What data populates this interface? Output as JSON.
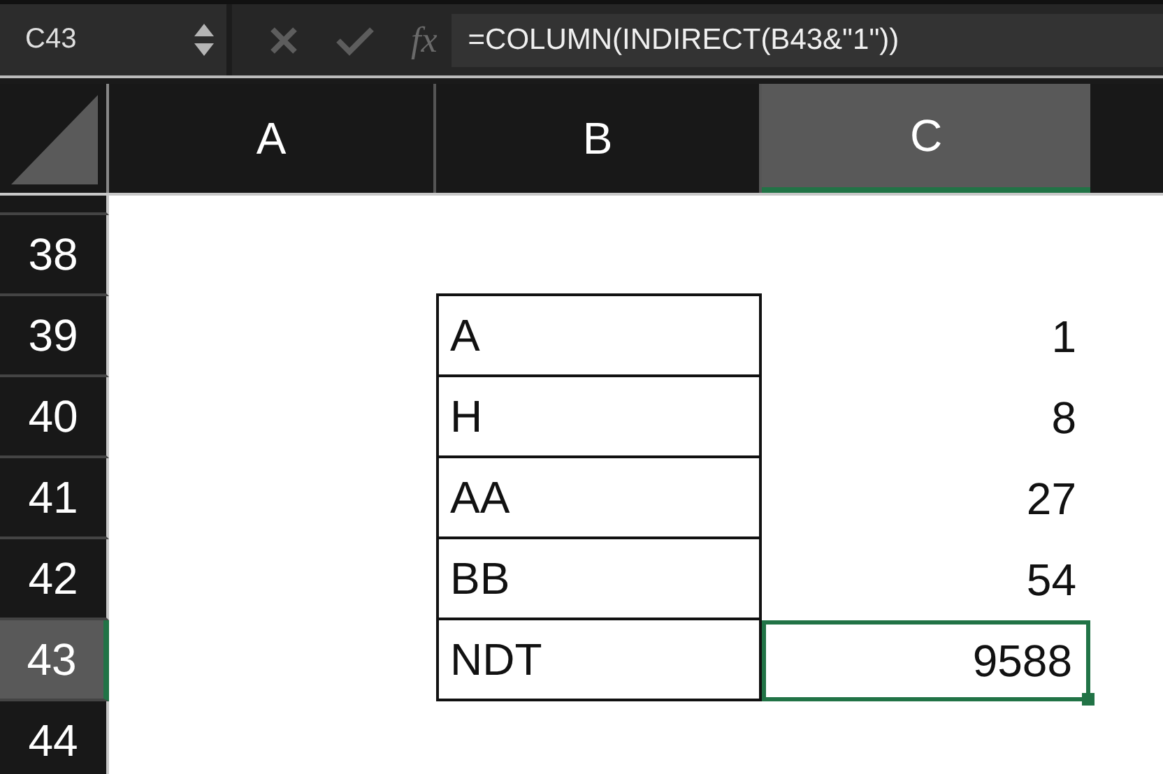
{
  "name_box": "C43",
  "formula_bar": {
    "fx_label": "fx",
    "formula": "=COLUMN(INDIRECT(B43&\"1\"))"
  },
  "columns": [
    {
      "label": "A",
      "selected": false
    },
    {
      "label": "B",
      "selected": false
    },
    {
      "label": "C",
      "selected": true
    }
  ],
  "rows": [
    {
      "header": "38",
      "selected": false,
      "boxed": false
    },
    {
      "header": "39",
      "selected": false,
      "boxed": true,
      "b": "A",
      "c": "1"
    },
    {
      "header": "40",
      "selected": false,
      "boxed": true,
      "b": "H",
      "c": "8"
    },
    {
      "header": "41",
      "selected": false,
      "boxed": true,
      "b": "AA",
      "c": "27"
    },
    {
      "header": "42",
      "selected": false,
      "boxed": true,
      "b": "BB",
      "c": "54"
    },
    {
      "header": "43",
      "selected": true,
      "boxed": true,
      "b": "NDT",
      "c": "9588"
    },
    {
      "header": "44",
      "selected": false,
      "boxed": false
    }
  ]
}
